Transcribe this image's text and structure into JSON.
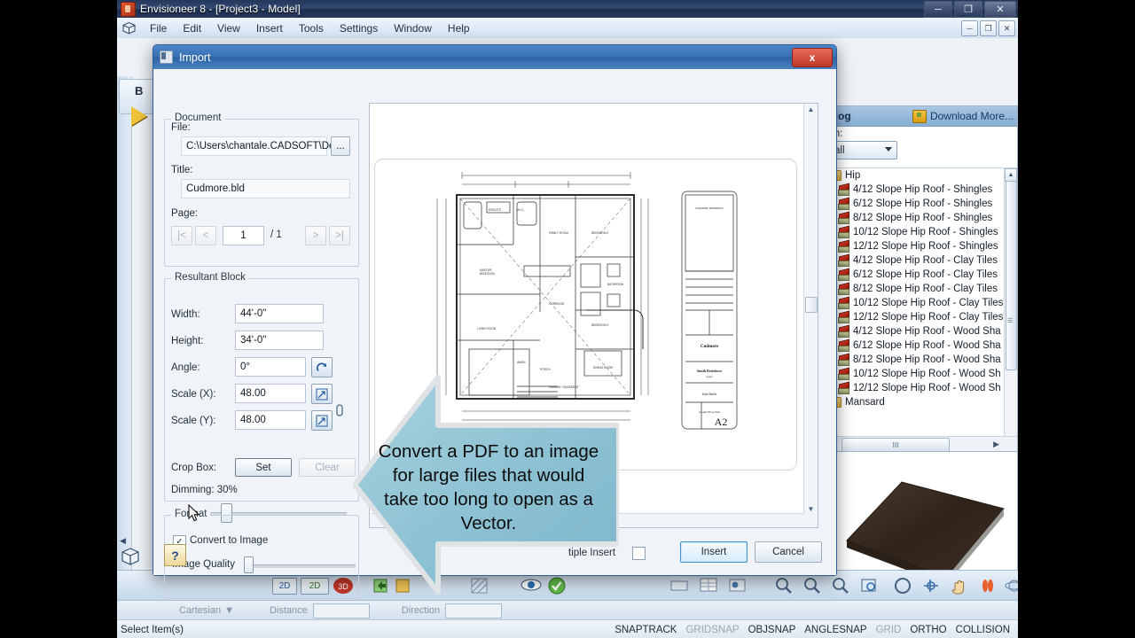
{
  "app": {
    "title": "Envisioneer 8 - [Project3 - Model]",
    "icon": "app-logo-icon",
    "window_buttons": [
      "minimize",
      "restore",
      "close"
    ],
    "mdi_buttons": [
      "minimize",
      "restore",
      "close"
    ],
    "menu": [
      "File",
      "Edit",
      "View",
      "Insert",
      "Tools",
      "Settings",
      "Window",
      "Help"
    ],
    "background_toolbar_label": "B"
  },
  "catalog": {
    "header_title": "alog",
    "download_more": "Download More...",
    "search_label": "ch:",
    "filter_value": "all",
    "groups": [
      {
        "label": "Hip",
        "type": "folder"
      }
    ],
    "items": [
      "4/12 Slope Hip Roof - Shingles",
      "6/12 Slope Hip Roof - Shingles",
      "8/12 Slope Hip Roof - Shingles",
      "10/12 Slope Hip Roof - Shingles",
      "12/12 Slope Hip Roof - Shingles",
      "4/12 Slope Hip Roof - Clay Tiles",
      "6/12 Slope Hip Roof - Clay Tiles",
      "8/12 Slope Hip Roof - Clay Tiles",
      "10/12 Slope Hip Roof - Clay Tiles",
      "12/12 Slope Hip Roof - Clay Tiles",
      "4/12 Slope Hip Roof - Wood Sha",
      "6/12 Slope Hip Roof - Wood Sha",
      "8/12 Slope Hip Roof - Wood Sha",
      "10/12 Slope Hip Roof - Wood Sh",
      "12/12 Slope Hip Roof - Wood Sh"
    ],
    "footer_group": "Mansard",
    "hscroll_grip": "III"
  },
  "dialog": {
    "title": "Import",
    "close_label": "x",
    "document": {
      "group_label": "Document",
      "file_label": "File:",
      "file_value": "C:\\Users\\chantale.CADSOFT\\De",
      "browse_label": "...",
      "title_label": "Title:",
      "title_value": "Cudmore.bld",
      "page_label": "Page:",
      "page_first": "|<",
      "page_prev": "<",
      "page_value": "1",
      "page_total": "/ 1",
      "page_next": ">",
      "page_last": ">|"
    },
    "resultant_block": {
      "group_label": "Resultant Block",
      "width_label": "Width:",
      "width_value": "44'-0\"",
      "height_label": "Height:",
      "height_value": "34'-0\"",
      "angle_label": "Angle:",
      "angle_value": "0°",
      "scale_x_label": "Scale (X):",
      "scale_x_value": "48.00",
      "scale_y_label": "Scale (Y):",
      "scale_y_value": "48.00",
      "crop_box_label": "Crop Box:",
      "crop_set": "Set",
      "crop_clear": "Clear",
      "dimming_label": "Dimming: 30%",
      "dimming_percent": 30
    },
    "format": {
      "group_label": "Format",
      "convert_label": "Convert to Image",
      "convert_checked": true,
      "check_glyph": "✓",
      "image_quality_label": "Image Quality",
      "image_quality_percent": 2
    },
    "help_label": "?",
    "footer": {
      "multiple_insert_label": "tiple Insert",
      "multiple_insert_checked": false,
      "insert_label": "Insert",
      "cancel_label": "Cancel"
    },
    "preview": {
      "sheet_number": "A2"
    }
  },
  "callout": {
    "text": "Convert a PDF to an image for large files that would take too long to open as a Vector.",
    "fill_color": "#8fc3d4",
    "border_color": "#d8dde0"
  },
  "bottom_toolbar": {
    "view_2d": "2D",
    "view_e2d": "2D",
    "view_3d": "3D"
  },
  "coordbar": {
    "cartesian_label": "Cartesian",
    "distance_label": "Distance",
    "direction_label": "Direction",
    "distance_value": "",
    "direction_value": ""
  },
  "statusbar": {
    "message": "Select Item(s)",
    "toggles": [
      {
        "label": "SNAPTRACK",
        "active": true
      },
      {
        "label": "GRIDSNAP",
        "active": false
      },
      {
        "label": "OBJSNAP",
        "active": true
      },
      {
        "label": "ANGLESNAP",
        "active": true
      },
      {
        "label": "GRID",
        "active": false
      },
      {
        "label": "ORTHO",
        "active": true
      },
      {
        "label": "COLLISION",
        "active": true
      }
    ]
  }
}
